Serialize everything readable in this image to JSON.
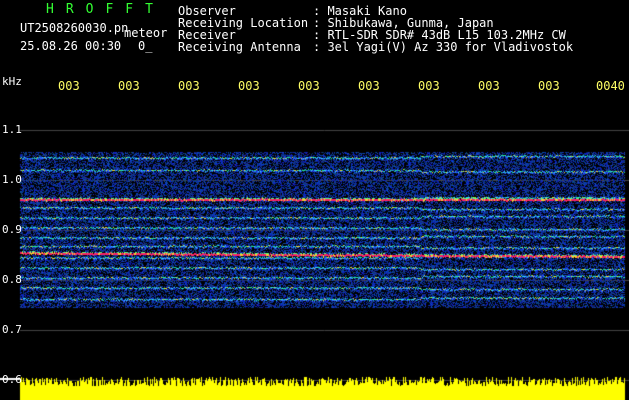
{
  "app": {
    "title": "HROFFT",
    "title_color": "#33ff33"
  },
  "file": {
    "name": "UT2508260030.pn",
    "mode": "meteor",
    "timestamp": "25.08.26 00:30",
    "count": "0_"
  },
  "info": {
    "labels": [
      "Observer",
      "Receiving Location",
      "Receiver",
      "Receiving Antenna"
    ],
    "values": [
      ": Masaki Kano",
      ": Shibukawa, Gunma, Japan",
      ": RTL-SDR SDR# 43dB L15 103.2MHz CW",
      ": 3el Yagi(V) Az 330 for Vladivostok"
    ]
  },
  "axis": {
    "unit": "kHz",
    "y_ticks": [
      "1.1",
      "1.0",
      "0.9",
      "0.8",
      "0.7",
      "0.6"
    ],
    "time_ticks": [
      "003",
      "003",
      "003",
      "003",
      "003",
      "003",
      "003",
      "003",
      "003",
      "0040"
    ]
  },
  "colors": {
    "text": "#ffffff",
    "title": "#33ff33",
    "time_ticks": "#ffff66",
    "background": "#000000",
    "signal_strong": "#ff2266",
    "signal_mid": "#33ff66",
    "noise": "#2244cc",
    "meteor_counter": "#ffff00"
  },
  "spectrogram": {
    "freq_range_khz": [
      0.6,
      1.15
    ],
    "lines_khz": [
      1.045,
      1.02,
      0.962,
      0.945,
      0.925,
      0.905,
      0.885,
      0.868,
      0.845,
      0.825,
      0.805,
      0.785,
      0.762
    ],
    "strong_lines_khz": [
      0.962,
      0.855
    ]
  }
}
